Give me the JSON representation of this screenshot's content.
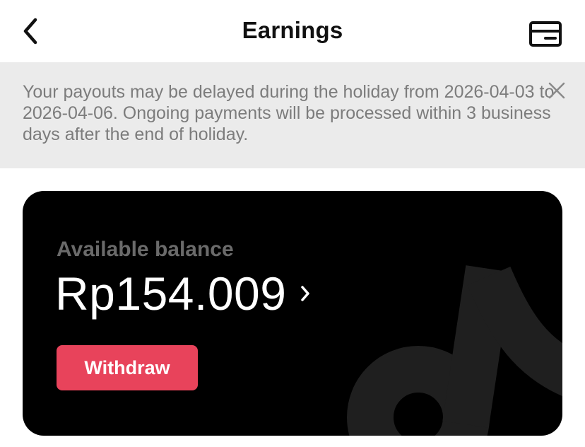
{
  "header": {
    "title": "Earnings",
    "back_icon": "chevron-left-icon",
    "card_icon": "credit-card-icon"
  },
  "banner": {
    "message": "Your payouts may be delayed during the holiday from 2026-04-03 to 2026-04-06. Ongoing payments will be processed within 3 business days after the end of holiday.",
    "close_icon": "close-icon"
  },
  "balance_card": {
    "label": "Available balance",
    "amount": "Rp154.009",
    "chevron_icon": "chevron-right-icon",
    "withdraw_label": "Withdraw",
    "logo_icon": "brand-logo-watermark"
  },
  "colors": {
    "accent": "#e8435b",
    "card_background": "#000000",
    "banner_background": "#ebebeb",
    "banner_text": "#7c7c7c",
    "label_text": "#6a6a6a"
  }
}
